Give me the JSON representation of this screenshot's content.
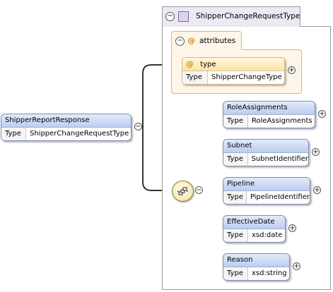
{
  "root": {
    "name": "ShipperReportResponse",
    "type_label": "Type",
    "type_value": "ShipperChangeRequestType"
  },
  "complex_type": {
    "title": "ShipperChangeRequestType"
  },
  "attributes": {
    "title": "attributes",
    "at_symbol": "@",
    "items": [
      {
        "name": "type",
        "type_label": "Type",
        "type_value": "ShipperChangeType"
      }
    ]
  },
  "elements": [
    {
      "name": "RoleAssignments",
      "type_label": "Type",
      "type_value": "RoleAssignments"
    },
    {
      "name": "Subnet",
      "type_label": "Type",
      "type_value": "SubnetIdentifier"
    },
    {
      "name": "Pipeline",
      "type_label": "Type",
      "type_value": "PipelineIdentifier"
    },
    {
      "name": "EffectiveDate",
      "type_label": "Type",
      "type_value": "xsd:date"
    },
    {
      "name": "Reason",
      "type_label": "Type",
      "type_value": "xsd:string"
    }
  ],
  "toggles": {
    "collapse": "−",
    "expand": "+"
  },
  "colors": {
    "connector": "#333333",
    "frame": "#9a9a9a",
    "element_header": "#bccdee",
    "attribute_header": "#fbe3a8"
  }
}
